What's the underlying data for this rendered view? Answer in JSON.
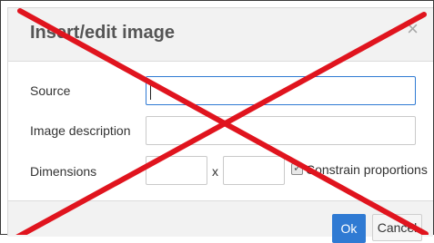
{
  "dialog": {
    "title": "Insert/edit image",
    "close_glyph": "×"
  },
  "form": {
    "source_label": "Source",
    "source_value": "",
    "description_label": "Image description",
    "description_value": "",
    "dimensions_label": "Dimensions",
    "width_value": "",
    "height_value": "",
    "times_glyph": "x",
    "constrain_label": "Constrain proportions",
    "constrain_checked": true
  },
  "footer": {
    "ok_label": "Ok",
    "cancel_label": "Cancel"
  },
  "colors": {
    "accent": "#2f7ad3",
    "cross": "#e0141e"
  }
}
